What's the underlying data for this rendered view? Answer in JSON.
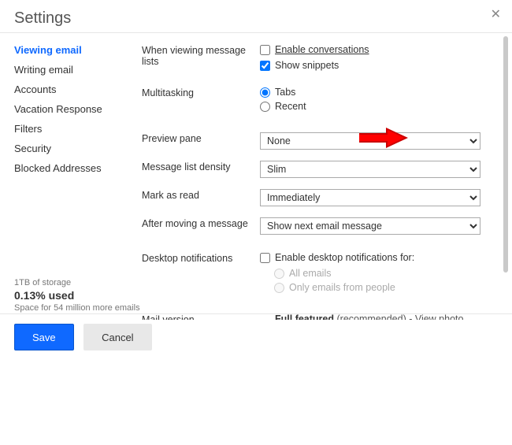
{
  "header": {
    "title": "Settings"
  },
  "sidebar": {
    "items": [
      "Viewing email",
      "Writing email",
      "Accounts",
      "Vacation Response",
      "Filters",
      "Security",
      "Blocked Addresses"
    ]
  },
  "settings": {
    "message_lists": {
      "label": "When viewing message lists",
      "opt1": "Enable conversations",
      "opt2": "Show snippets"
    },
    "multitasking": {
      "label": "Multitasking",
      "opt1": "Tabs",
      "opt2": "Recent"
    },
    "preview_pane": {
      "label": "Preview pane",
      "value": "None"
    },
    "density": {
      "label": "Message list density",
      "value": "Slim"
    },
    "mark_read": {
      "label": "Mark as read",
      "value": "Immediately"
    },
    "after_move": {
      "label": "After moving a message",
      "value": "Show next email message"
    },
    "desktop_notif": {
      "label": "Desktop notifications",
      "enable": "Enable desktop notifications for:",
      "opt1": "All emails",
      "opt2": "Only emails from people"
    },
    "mail_version": {
      "label": "Mail version",
      "opt1": "Full featured",
      "opt1_desc": " (recommended) - View photo slideshows, drag and drop attachments, personalize your theme,"
    }
  },
  "storage": {
    "total": "1TB of storage",
    "used": "0.13% used",
    "line": "Space for 54 million more emails"
  },
  "footer": {
    "save": "Save",
    "cancel": "Cancel"
  }
}
